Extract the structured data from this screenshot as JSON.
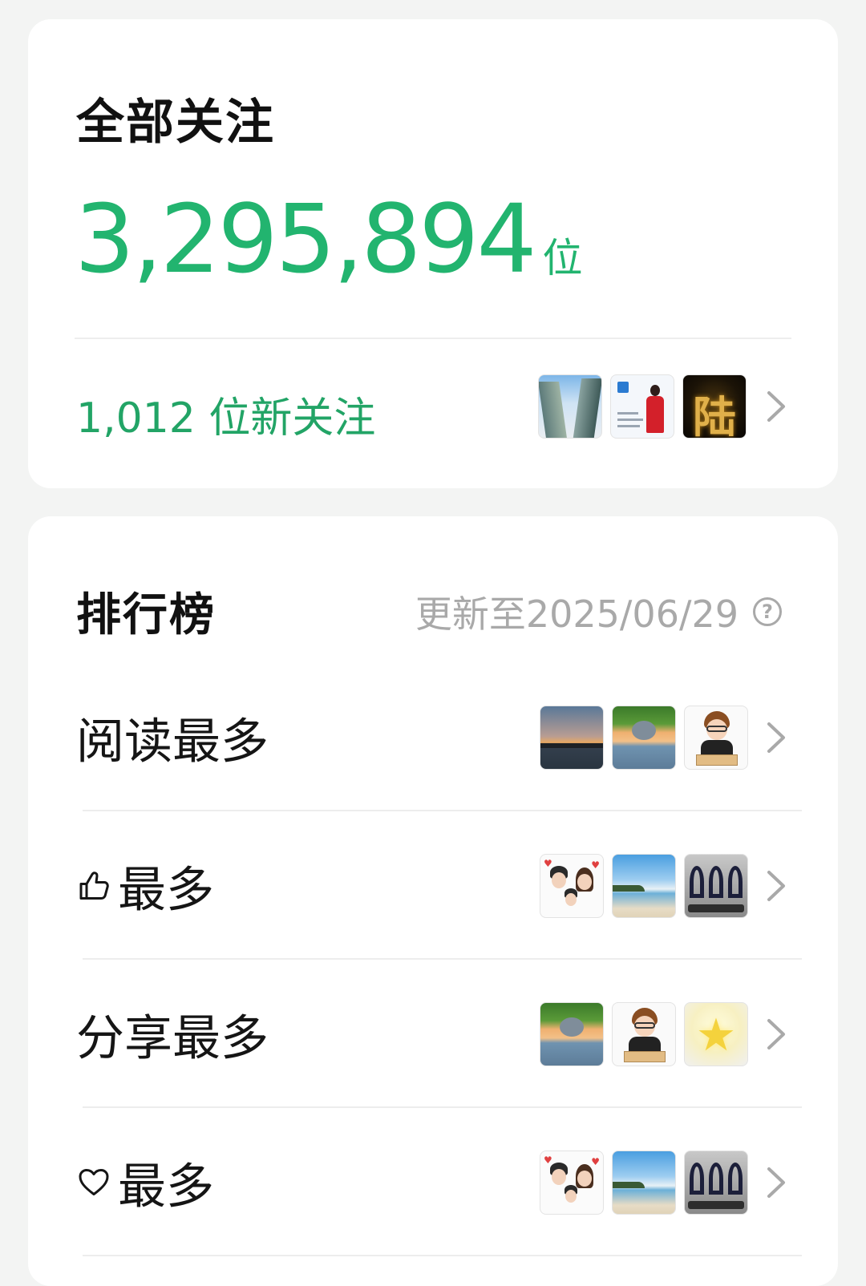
{
  "followers": {
    "title": "全部关注",
    "count": "3,295,894",
    "count_unit": "位",
    "new_followers": "1,012 位新关注",
    "thumbnails": [
      "skyscrapers-photo",
      "business-card-photo",
      "gold-character-photo"
    ]
  },
  "ranking": {
    "title": "排行榜",
    "updated": "更新至2025/06/29",
    "help_icon": "?",
    "rows": [
      {
        "label": "阅读最多",
        "icon": "",
        "thumbnails": [
          "sunset-photo",
          "tree-sea-photo",
          "cartoon-man-avatar"
        ]
      },
      {
        "label": "最多",
        "icon": "thumbs-up-icon",
        "thumbnails": [
          "family-cartoon-avatar",
          "beach-photo",
          "ribbon-sculpture-photo"
        ]
      },
      {
        "label": "分享最多",
        "icon": "",
        "thumbnails": [
          "tree-sea-photo",
          "cartoon-man-avatar",
          "star-photo"
        ]
      },
      {
        "label": "最多",
        "icon": "heart-icon",
        "thumbnails": [
          "family-cartoon-avatar",
          "beach-photo",
          "ribbon-sculpture-photo"
        ]
      }
    ]
  },
  "colors": {
    "accent_green": "#22b46f",
    "muted_gray": "#a9a9a9",
    "background": "#f3f4f3"
  }
}
